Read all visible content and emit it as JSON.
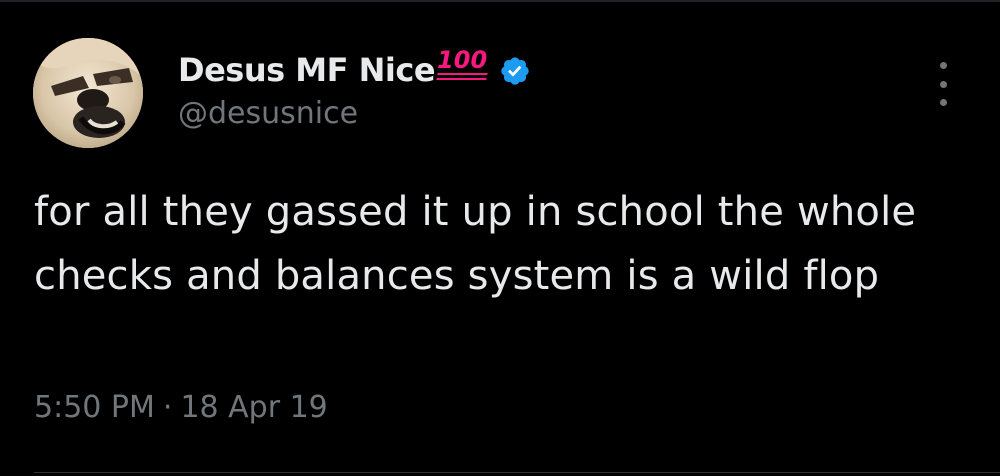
{
  "tweet": {
    "author": {
      "display_name": "Desus MF Nice",
      "name_emoji": "100",
      "handle": "@desusnice",
      "verified": true,
      "avatar_icon": "avatar-photo",
      "verified_icon": "verified-badge-icon"
    },
    "text": "for all they gassed it up in school the whole checks and balances system is a wild flop",
    "time": "5:50 PM",
    "separator": "·",
    "date": "18 Apr 19",
    "more_icon": "more-options-icon"
  },
  "colors": {
    "background": "#000000",
    "primary_text": "#e7e9ea",
    "secondary_text": "#71767b",
    "verified_blue": "#1d9bf0",
    "emoji_red": "#f91880",
    "divider": "#2f3336"
  }
}
